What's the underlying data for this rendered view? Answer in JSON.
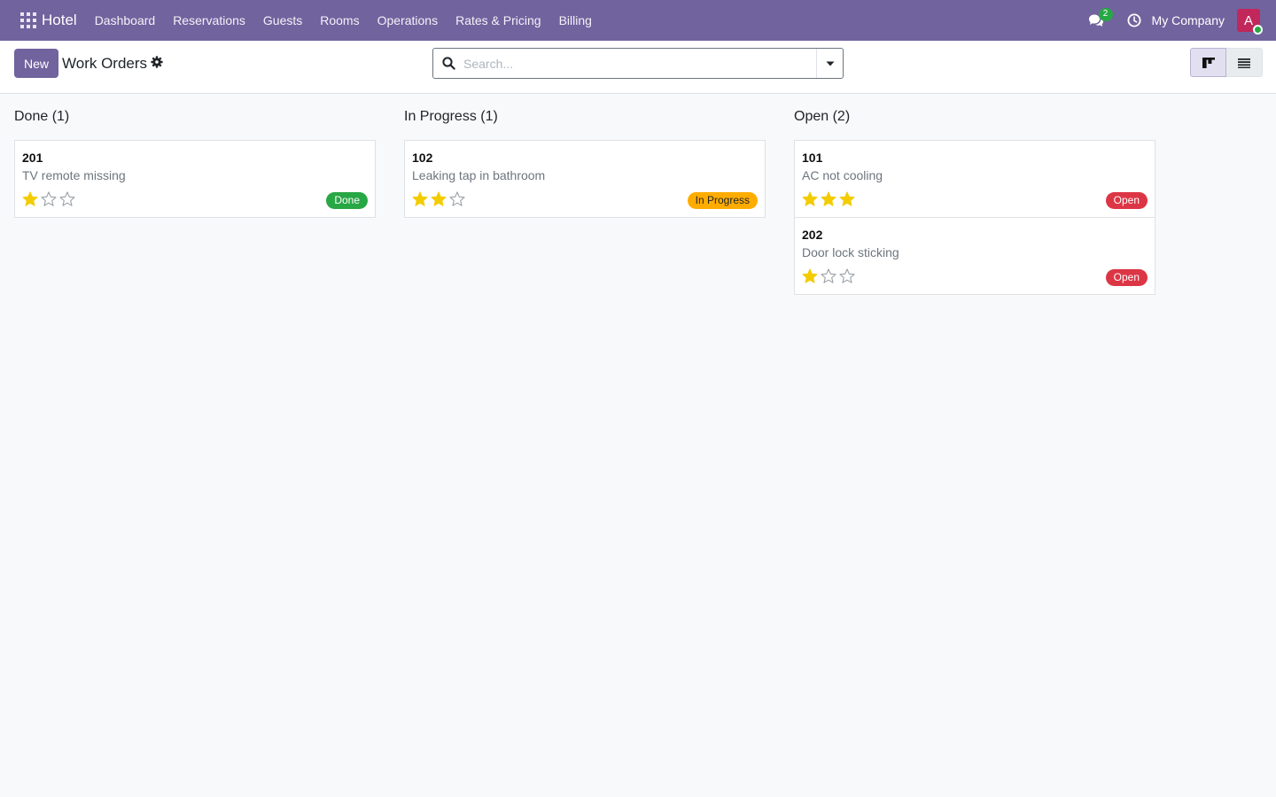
{
  "navbar": {
    "brand": "Hotel",
    "menu": [
      "Dashboard",
      "Reservations",
      "Guests",
      "Rooms",
      "Operations",
      "Rates & Pricing",
      "Billing"
    ],
    "chat_count": "2",
    "company": "My Company",
    "avatar_letter": "A",
    "colors": {
      "navbar": "#71639e",
      "avatar": "#c1275a",
      "online": "#28a745"
    }
  },
  "control_panel": {
    "new_label": "New",
    "title": "Work Orders",
    "search_placeholder": "Search..."
  },
  "kanban": {
    "columns": [
      {
        "title": "Done (1)",
        "cards": [
          {
            "number": "201",
            "description": "TV remote missing",
            "priority": 1,
            "status": "Done",
            "status_class": "done"
          }
        ]
      },
      {
        "title": "In Progress (1)",
        "cards": [
          {
            "number": "102",
            "description": "Leaking tap in bathroom",
            "priority": 2,
            "status": "In Progress",
            "status_class": "progress"
          }
        ]
      },
      {
        "title": "Open (2)",
        "cards": [
          {
            "number": "101",
            "description": "AC not cooling",
            "priority": 3,
            "status": "Open",
            "status_class": "open"
          },
          {
            "number": "202",
            "description": "Door lock sticking",
            "priority": 1,
            "status": "Open",
            "status_class": "open"
          }
        ]
      }
    ],
    "status_colors": {
      "done": "#28a745",
      "progress": "#ffac00",
      "open": "#dc3545",
      "star": "#f3cc00"
    }
  }
}
